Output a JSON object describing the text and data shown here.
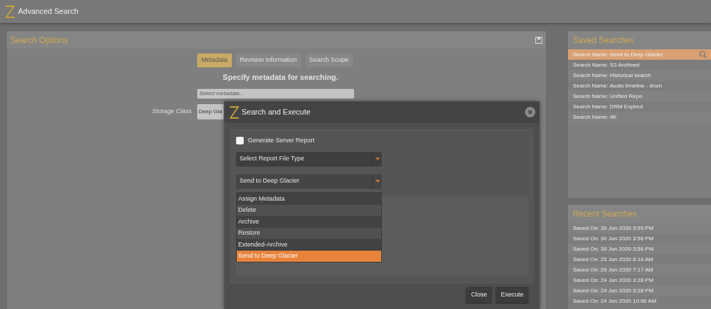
{
  "window": {
    "title": "Advanced Search"
  },
  "search_options": {
    "title": "Search Options",
    "tabs": [
      {
        "label": "Metadata",
        "selected": true
      },
      {
        "label": "Revision Information",
        "selected": false
      },
      {
        "label": "Search Scope",
        "selected": false
      }
    ],
    "instruction": "Specify metadata for searching.",
    "metadata_field": {
      "placeholder": "Select metadata..."
    },
    "storage_class": {
      "label": "Storage Class",
      "value": "Deep Gla"
    }
  },
  "saved_searches": {
    "title": "Saved Searches",
    "items": [
      {
        "label": "Search Name: Send to Deep Glacier",
        "selected": true
      },
      {
        "label": "Search Name: S3 Archived",
        "selected": false
      },
      {
        "label": "Search Name: Historical search",
        "selected": false
      },
      {
        "label": "Search Name: Audio timeline - drum",
        "selected": false
      },
      {
        "label": "Search Name: Unified Repo",
        "selected": false
      },
      {
        "label": "Search Name: DRM Expired",
        "selected": false
      },
      {
        "label": "Search Name: 4K",
        "selected": false
      }
    ]
  },
  "recent_searches": {
    "title": "Recent Searches",
    "items": [
      "Saved On: 30 Jun 2020 3:59 PM",
      "Saved On: 30 Jun 2020 3:56 PM",
      "Saved On: 30 Jun 2020 3:56 PM",
      "Saved On: 25 Jun 2020 8:18 AM",
      "Saved On: 25 Jun 2020 7:17 AM",
      "Saved On: 24 Jun 2020 3:28 PM",
      "Saved On: 24 Jun 2020 3:28 PM",
      "Saved On: 24 Jun 2020 10:06 AM"
    ]
  },
  "dialog": {
    "title": "Search and Execute",
    "report_checkbox": {
      "label": "Generate Server Report",
      "checked": false
    },
    "report_type": {
      "value": "Select Report File Type"
    },
    "action": {
      "value": "Send to Deep Glacier",
      "expanded": true,
      "options": [
        {
          "label": "Assign Metadata",
          "selected": false
        },
        {
          "label": "Delete",
          "selected": false
        },
        {
          "label": "Archive",
          "selected": false
        },
        {
          "label": "Restore",
          "selected": false
        },
        {
          "label": "Extended-Archive",
          "selected": false
        },
        {
          "label": "Send to Deep Glacier",
          "selected": true
        }
      ]
    },
    "buttons": [
      "Close",
      "Execute"
    ]
  }
}
